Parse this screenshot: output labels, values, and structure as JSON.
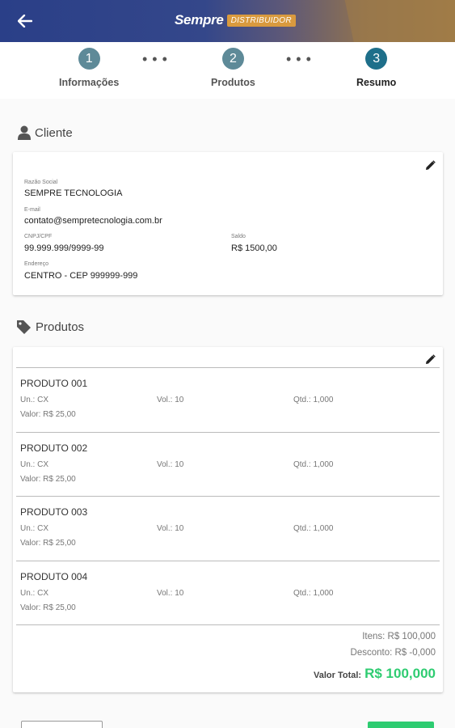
{
  "header": {
    "logo_main": "Sempre",
    "logo_tag": "DISTRIBUIDOR"
  },
  "stepper": {
    "steps": [
      {
        "number": "1",
        "label": "Informações"
      },
      {
        "number": "2",
        "label": "Produtos"
      },
      {
        "number": "3",
        "label": "Resumo"
      }
    ],
    "dots": "•••"
  },
  "cliente": {
    "title": "Cliente",
    "razao_social_label": "Razão Social",
    "razao_social": "SEMPRE TECNOLOGIA",
    "email_label": "E-mail",
    "email": "contato@sempretecnologia.com.br",
    "cnpj_label": "CNPJ/CPF",
    "cnpj": "99.999.999/9999-99",
    "saldo_label": "Saldo",
    "saldo": "R$ 1500,00",
    "endereco_label": "Endereço",
    "endereco": "CENTRO - CEP 999999-999"
  },
  "produtos": {
    "title": "Produtos",
    "items": [
      {
        "name": "PRODUTO 001",
        "un": "Un.: CX",
        "vol": "Vol.: 10",
        "qtd": "Qtd.: 1,000",
        "valor": "Valor: R$ 25,00"
      },
      {
        "name": "PRODUTO 002",
        "un": "Un.: CX",
        "vol": "Vol.: 10",
        "qtd": "Qtd.: 1,000",
        "valor": "Valor: R$ 25,00"
      },
      {
        "name": "PRODUTO 003",
        "un": "Un.: CX",
        "vol": "Vol.: 10",
        "qtd": "Qtd.: 1,000",
        "valor": "Valor: R$ 25,00"
      },
      {
        "name": "PRODUTO 004",
        "un": "Un.: CX",
        "vol": "Vol.: 10",
        "qtd": "Qtd.: 1,000",
        "valor": "Valor: R$ 25,00"
      }
    ],
    "itens": "Itens: R$ 100,000",
    "desconto": "Desconto: R$ -0,000",
    "total_label": "Valor Total:",
    "total_value": "R$ 100,000"
  },
  "colors": {
    "header_start": "#2a3f88",
    "header_end": "#a07c47",
    "step": "#5e8a98",
    "step_active": "#1e6f8a",
    "total": "#2ecc71"
  }
}
